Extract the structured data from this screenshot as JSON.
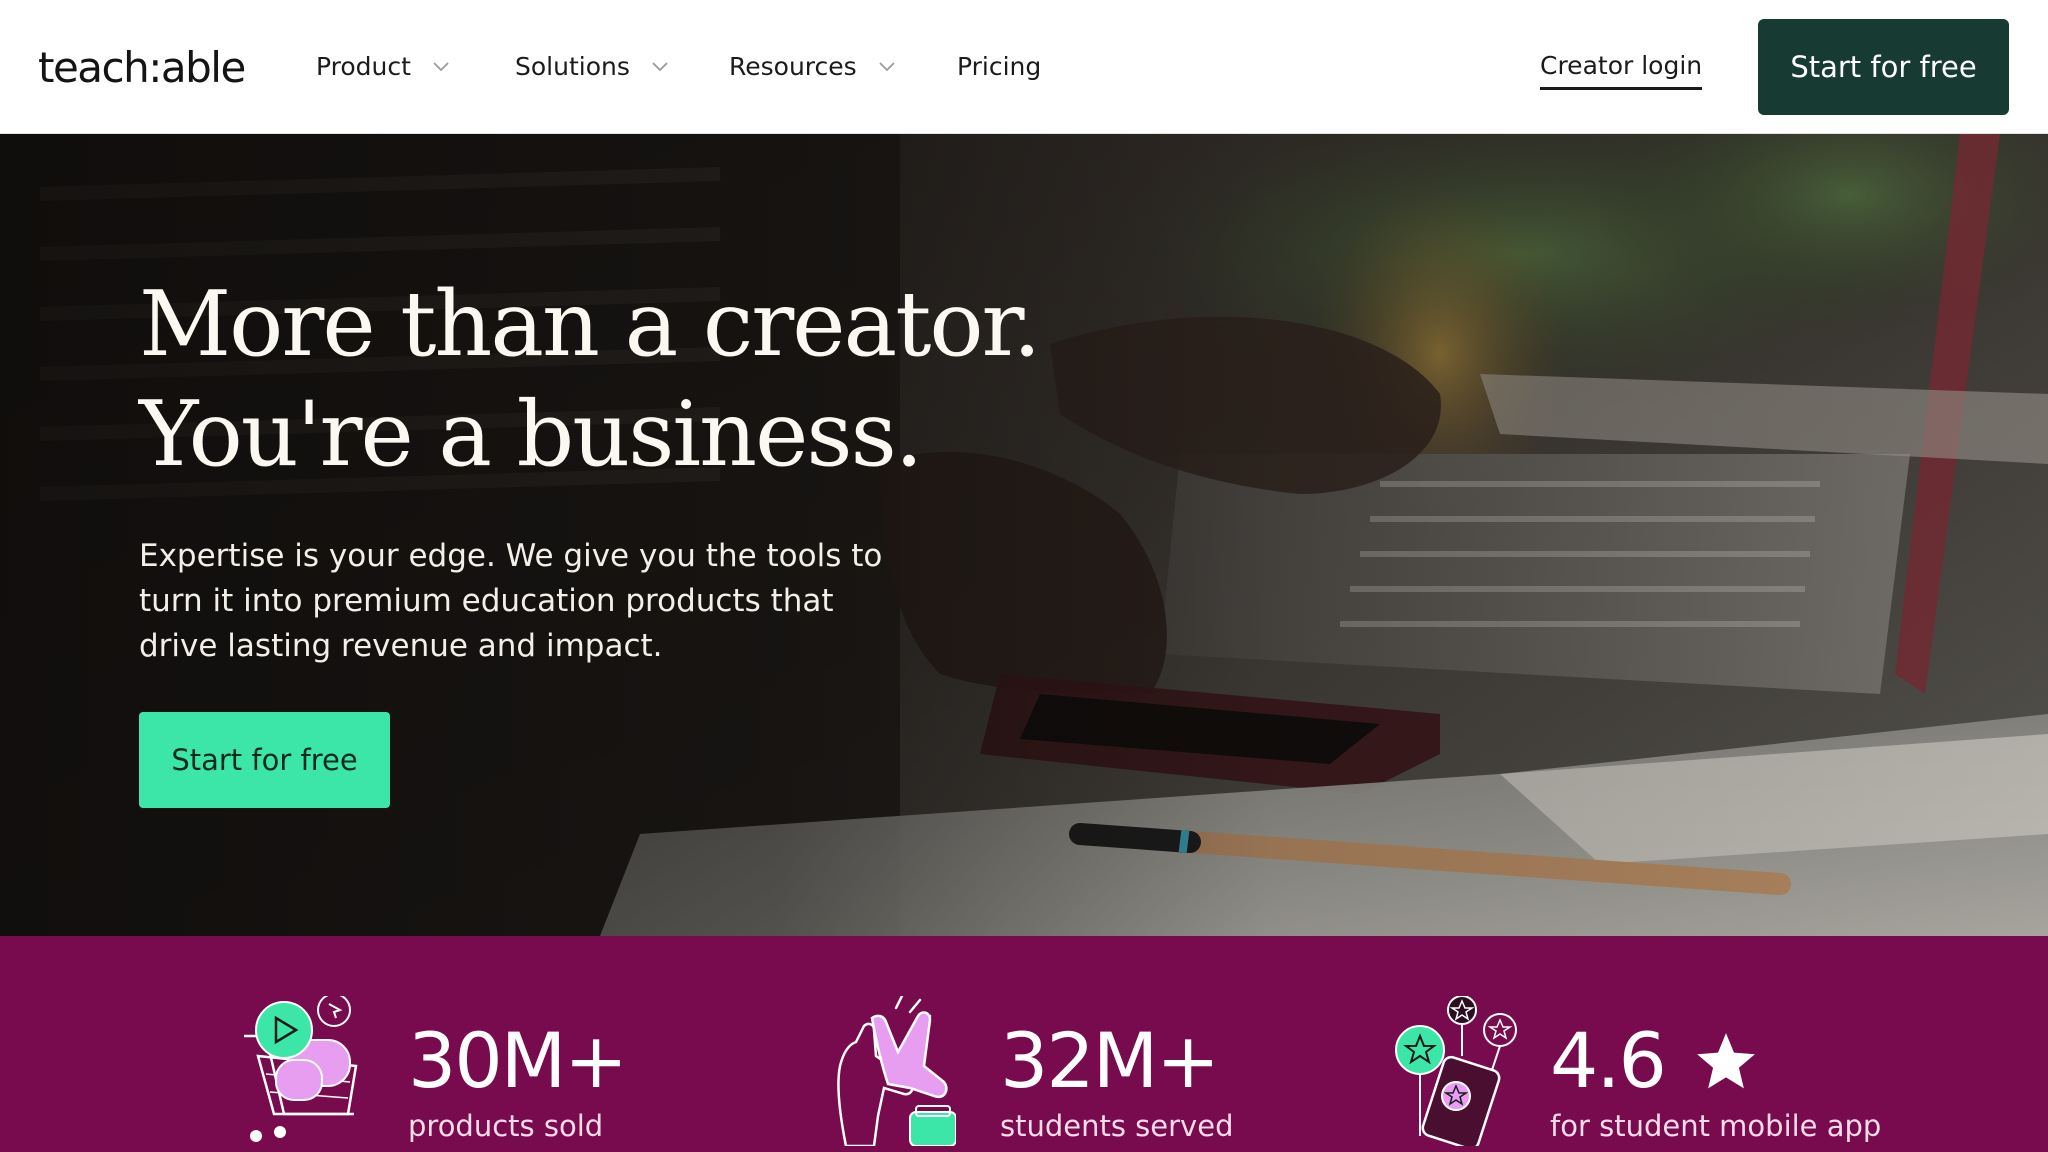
{
  "header": {
    "logo": "teach:able",
    "nav": [
      {
        "label": "Product",
        "has_dropdown": true
      },
      {
        "label": "Solutions",
        "has_dropdown": true
      },
      {
        "label": "Resources",
        "has_dropdown": true
      },
      {
        "label": "Pricing",
        "has_dropdown": false
      }
    ],
    "creator_login": "Creator login",
    "cta": "Start for free"
  },
  "hero": {
    "title_line1": "More than a creator.",
    "title_line2": "You're a business.",
    "subtitle": "Expertise is your edge. We give you the tools to turn it into premium education products that drive lasting revenue and impact.",
    "cta": "Start for free"
  },
  "stats": [
    {
      "value": "30M+",
      "label": "products sold",
      "icon": "shopping-cart-icon"
    },
    {
      "value": "32M+",
      "label": "students served",
      "icon": "high-five-icon"
    },
    {
      "value": "4.6",
      "label": "for student mobile app",
      "icon": "mobile-stars-icon",
      "suffix_icon": "star-icon"
    }
  ],
  "colors": {
    "header_cta_bg": "#173b33",
    "hero_cta_bg": "#3ce6a9",
    "stats_bg": "#780b4d",
    "icon_green": "#3ce6a9",
    "icon_pink": "#e79ef0"
  }
}
